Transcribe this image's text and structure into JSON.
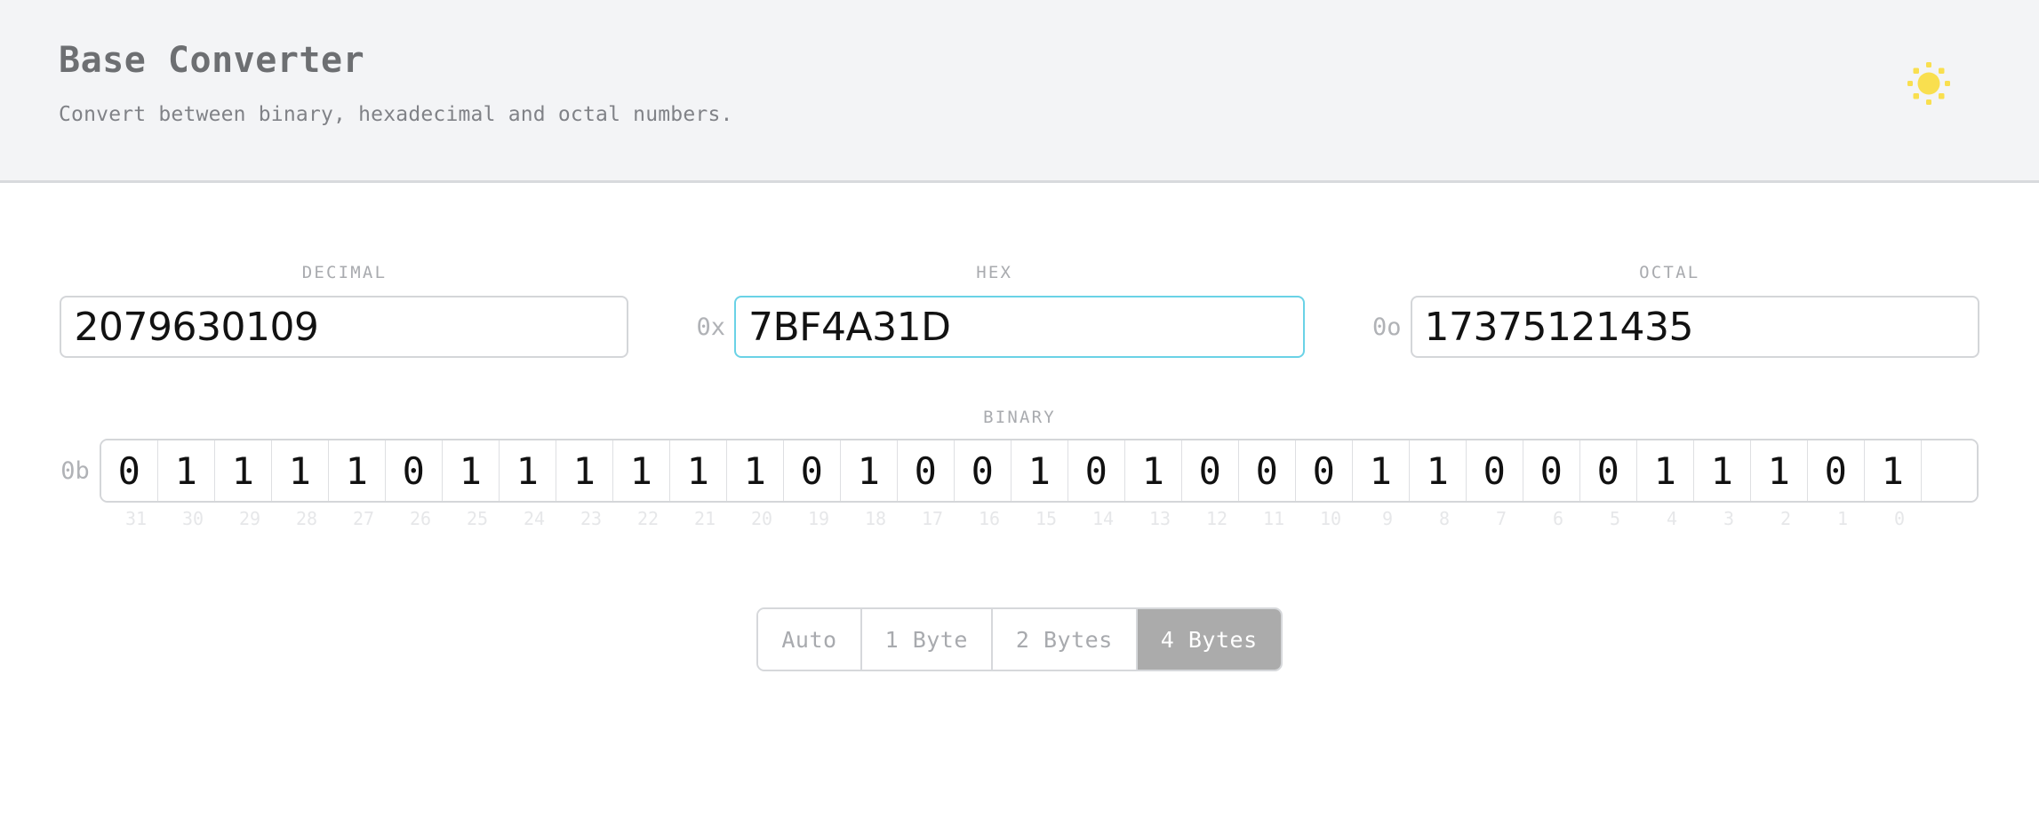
{
  "header": {
    "title": "Base Converter",
    "subtitle": "Convert between binary, hexadecimal and octal numbers.",
    "theme_toggle_icon": "sun-icon",
    "theme_toggle_color": "#f9df4f",
    "background": "#f3f4f6"
  },
  "fields": {
    "decimal": {
      "label": "DECIMAL",
      "prefix": "",
      "value": "2079630109",
      "placeholder": "0",
      "focused": false
    },
    "hex": {
      "label": "HEX",
      "prefix": "0x",
      "value": "7BF4A31D",
      "placeholder": "0",
      "focused": true,
      "focus_color": "#6ad2e6"
    },
    "octal": {
      "label": "OCTAL",
      "prefix": "0o",
      "value": "17375121435",
      "placeholder": "0",
      "focused": false
    }
  },
  "binary": {
    "label": "BINARY",
    "prefix": "0b",
    "bits": [
      "0",
      "1",
      "1",
      "1",
      "1",
      "0",
      "1",
      "1",
      "1",
      "1",
      "1",
      "1",
      "0",
      "1",
      "0",
      "0",
      "1",
      "0",
      "1",
      "0",
      "0",
      "0",
      "1",
      "1",
      "0",
      "0",
      "0",
      "1",
      "1",
      "1",
      "0",
      "1"
    ],
    "indices": [
      "31",
      "30",
      "29",
      "28",
      "27",
      "26",
      "25",
      "24",
      "23",
      "22",
      "21",
      "20",
      "19",
      "18",
      "17",
      "16",
      "15",
      "14",
      "13",
      "12",
      "11",
      "10",
      "9",
      "8",
      "7",
      "6",
      "5",
      "4",
      "3",
      "2",
      "1",
      "0"
    ]
  },
  "byte_size": {
    "options": [
      {
        "label": "Auto",
        "active": false
      },
      {
        "label": "1 Byte",
        "active": false
      },
      {
        "label": "2 Bytes",
        "active": false
      },
      {
        "label": "4 Bytes",
        "active": true
      }
    ],
    "active_background": "#ababab",
    "active_color": "#ffffff"
  }
}
